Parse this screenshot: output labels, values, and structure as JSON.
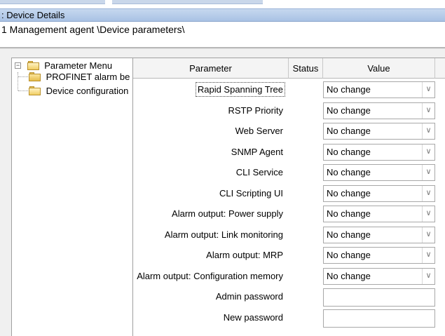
{
  "window": {
    "title": "Device Details",
    "title_prefix_char": ":",
    "path": "1 Management agent \\Device parameters\\"
  },
  "tree": {
    "root": {
      "label": "Parameter Menu",
      "expander": "−"
    },
    "children": [
      {
        "label": "PROFINET alarm be"
      },
      {
        "label": "Device configuration"
      }
    ]
  },
  "grid": {
    "headers": {
      "parameter": "Parameter",
      "status": "Status",
      "value": "Value"
    },
    "dropdown_glyph": "∨",
    "rows": [
      {
        "parameter": "Rapid Spanning Tree",
        "status": "",
        "value": "No change",
        "type": "select"
      },
      {
        "parameter": "RSTP Priority",
        "status": "",
        "value": "No change",
        "type": "select"
      },
      {
        "parameter": "Web Server",
        "status": "",
        "value": "No change",
        "type": "select"
      },
      {
        "parameter": "SNMP Agent",
        "status": "",
        "value": "No change",
        "type": "select"
      },
      {
        "parameter": "CLI Service",
        "status": "",
        "value": "No change",
        "type": "select"
      },
      {
        "parameter": "CLI Scripting UI",
        "status": "",
        "value": "No change",
        "type": "select"
      },
      {
        "parameter": "Alarm output: Power supply",
        "status": "",
        "value": "No change",
        "type": "select"
      },
      {
        "parameter": "Alarm output: Link monitoring",
        "status": "",
        "value": "No change",
        "type": "select"
      },
      {
        "parameter": "Alarm output: MRP",
        "status": "",
        "value": "No change",
        "type": "select"
      },
      {
        "parameter": "Alarm output: Configuration memory",
        "status": "",
        "value": "No change",
        "type": "select"
      },
      {
        "parameter": "Admin password",
        "status": "",
        "value": "",
        "type": "input"
      },
      {
        "parameter": "New password",
        "status": "",
        "value": "",
        "type": "input"
      }
    ]
  }
}
